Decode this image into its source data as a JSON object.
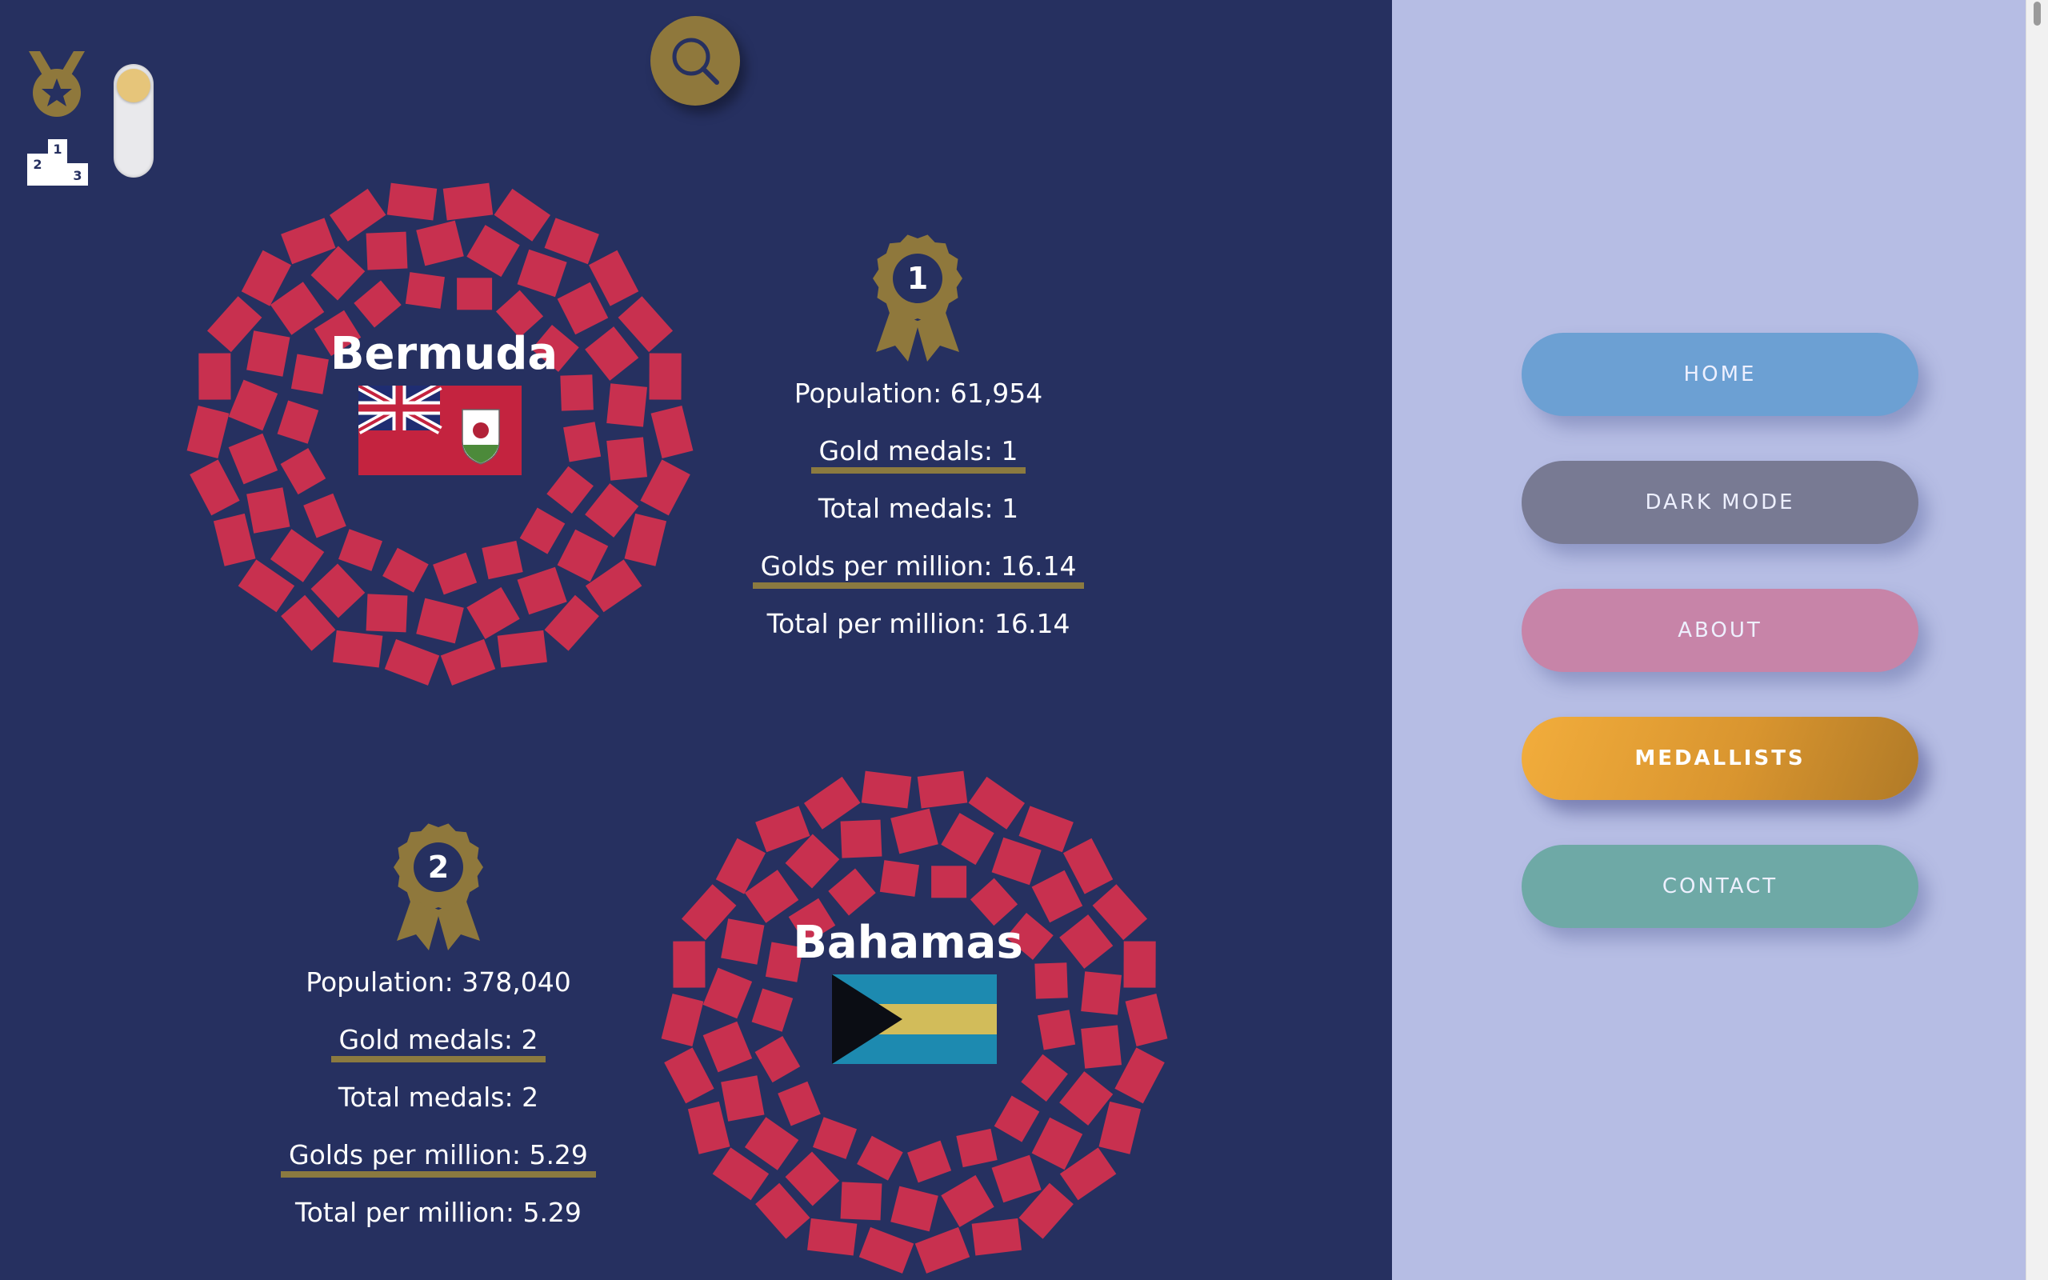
{
  "nav": {
    "home": "HOME",
    "dark_mode": "DARK MODE",
    "about": "ABOUT",
    "medallists": "MEDALLISTS",
    "contact": "CONTACT"
  },
  "podium_numbers": [
    "1",
    "2",
    "3"
  ],
  "countries": [
    {
      "rank": "1",
      "name": "Bermuda",
      "population": "Population: 61,954",
      "gold": "Gold medals: 1",
      "total": "Total medals: 1",
      "golds_per_million": "Golds per million: 16.14",
      "total_per_million": "Total per million: 16.14"
    },
    {
      "rank": "2",
      "name": "Bahamas",
      "population": "Population: 378,040",
      "gold": "Gold medals: 2",
      "total": "Total medals: 2",
      "golds_per_million": "Golds per million: 5.29",
      "total_per_million": "Total per million: 5.29"
    }
  ],
  "colors": {
    "background": "#263060",
    "sidebar": "#b6bde4",
    "accent_gold": "#8f783c",
    "emblem_red": "#c8304f",
    "active_nav": "#f2ad3c"
  },
  "icons": [
    "medal-icon",
    "podium-icon",
    "search-icon",
    "rank-ribbon-icon",
    "tokyo-emblem"
  ]
}
